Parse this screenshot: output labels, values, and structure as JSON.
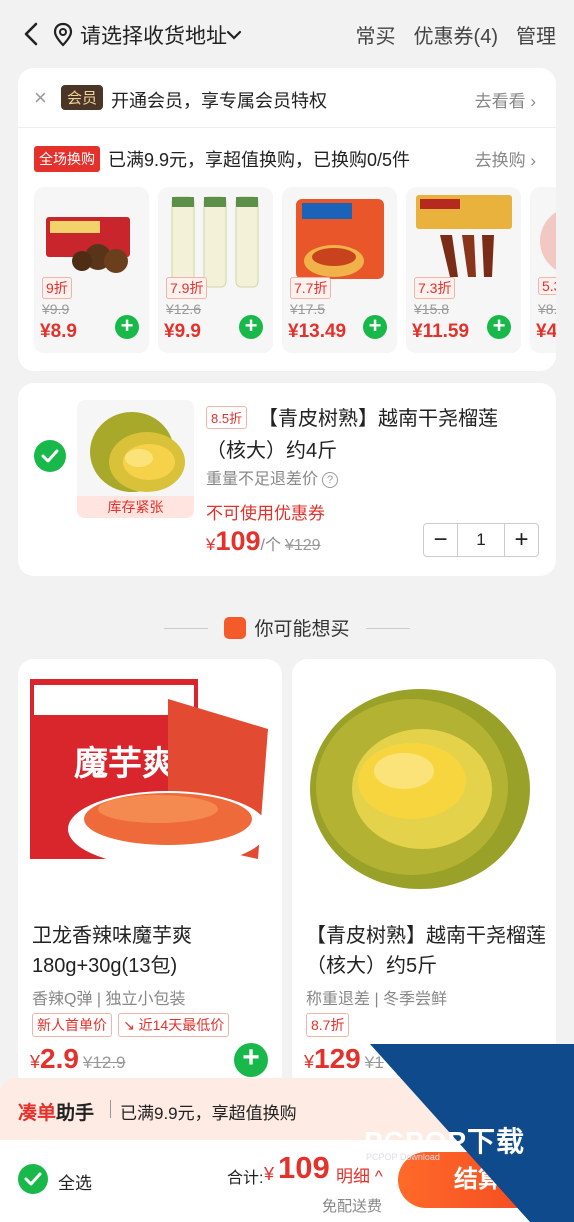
{
  "header": {
    "address_label": "请选择收货地址",
    "actions": [
      "常买",
      "优惠券(4)",
      "管理"
    ]
  },
  "member": {
    "badge": "会员",
    "text": "开通会员，享专属会员特权",
    "link": "去看看"
  },
  "swap": {
    "badge": "全场换购",
    "text": "已满9.9元，享超值换购，已换购0/5件",
    "link": "去换购",
    "products": [
      {
        "discount": "9折",
        "orig": "¥9.9",
        "price": "¥8.9"
      },
      {
        "discount": "7.9折",
        "orig": "¥12.6",
        "price": "¥9.9"
      },
      {
        "discount": "7.7折",
        "orig": "¥17.5",
        "price": "¥13.49"
      },
      {
        "discount": "7.3折",
        "orig": "¥15.8",
        "price": "¥11.59"
      },
      {
        "discount": "5.3",
        "orig": "¥8.",
        "price": "¥4"
      }
    ]
  },
  "cart_item": {
    "stock_tag": "库存紧张",
    "discount": "8.5折",
    "title": "【青皮树熟】越南干尧榴莲（核大）约4斤",
    "weight_note": "重量不足退差价",
    "coupon_note": "不可使用优惠券",
    "price_symbol": "¥",
    "price": "109",
    "unit": "/个",
    "orig": "¥129",
    "quantity": "1"
  },
  "section": {
    "title": "你可能想买"
  },
  "recommendations": [
    {
      "image_text": "魔芋爽",
      "brand_text": "卫龙",
      "title": "卫龙香辣味魔芋爽180g+30g(13包)",
      "sub": "香辣Q弹 | 独立小包装",
      "tags": [
        "新人首单价",
        "↘ 近14天最低价"
      ],
      "price_symbol": "¥",
      "price": "2.9",
      "orig": "¥12.9"
    },
    {
      "title": "【青皮树熟】越南干尧榴莲（核大）约5斤",
      "sub": "称重退差 | 冬季尝鲜",
      "tags": [
        "8.7折"
      ],
      "price_symbol": "¥",
      "price": "129",
      "orig": "¥1"
    }
  ],
  "helper": {
    "title_a": "凑单",
    "title_b": "助手",
    "text": "已满9.9元，享超值换购"
  },
  "bottom": {
    "select_all": "全选",
    "total_label": "合计:",
    "total_symbol": "¥",
    "total": "109",
    "detail": "明细 ^",
    "shipping": "免配送费",
    "checkout": "结算"
  },
  "watermark": {
    "text": "PCPOP下载",
    "sub": "PCPOP Download"
  },
  "colors": {
    "accent": "#e4312b",
    "green": "#19b84a",
    "checkout": "#f2461e",
    "watermark_blue": "#0e4a8c"
  }
}
